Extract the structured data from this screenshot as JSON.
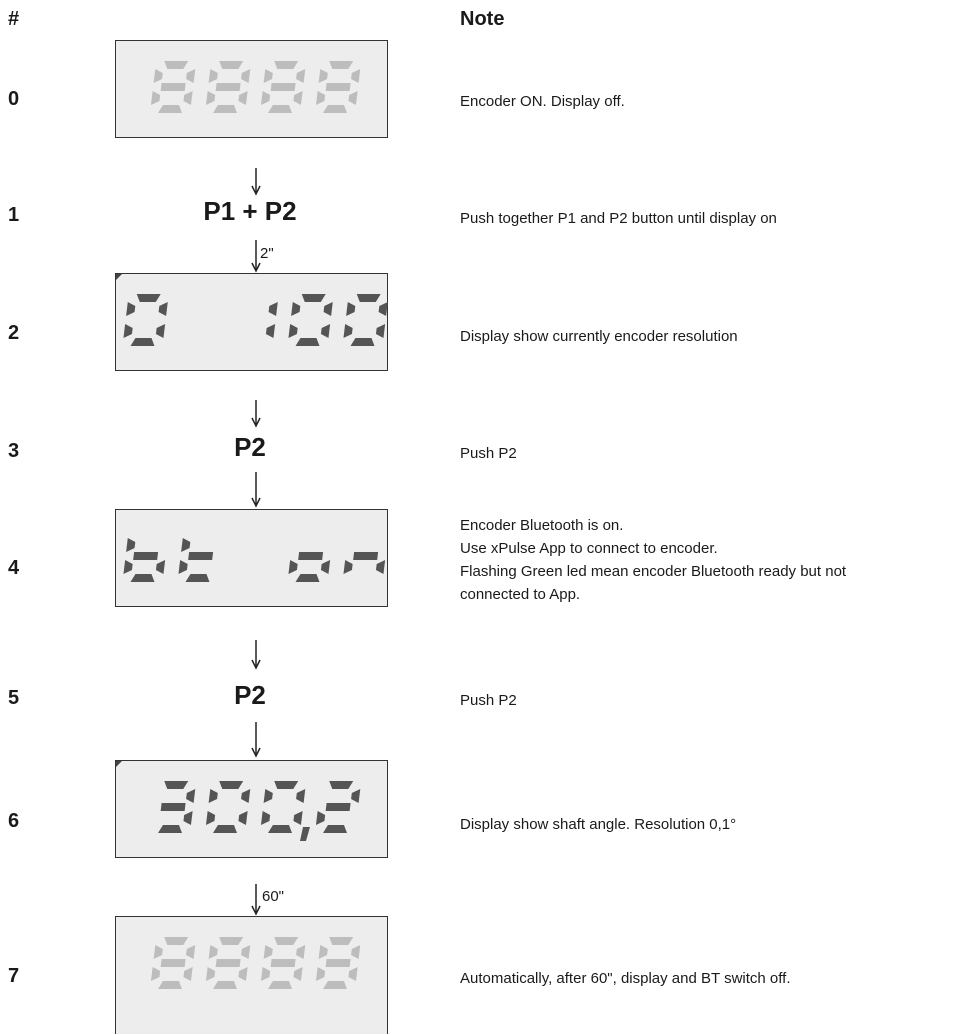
{
  "header": {
    "step_col": "#",
    "note_col": "Note"
  },
  "steps": [
    {
      "num": "0",
      "display": "8888",
      "dim": true,
      "notes": [
        "Encoder ON. Display off."
      ]
    },
    {
      "num": "1",
      "button": "P1 + P2",
      "notes": [
        "Push together P1 and P2 button until display on"
      ]
    },
    {
      "num": "2",
      "display": "0 100",
      "dim": false,
      "notes": [
        "Display show currently encoder resolution"
      ]
    },
    {
      "num": "3",
      "button": "P2",
      "notes": [
        "Push P2"
      ]
    },
    {
      "num": "4",
      "display": "bt on",
      "dim": false,
      "notes": [
        "Encoder Bluetooth is on.",
        "Use xPulse App to connect to encoder.",
        "Flashing Green led mean encoder Bluetooth ready but not",
        "connected to App."
      ]
    },
    {
      "num": "5",
      "button": "P2",
      "notes": [
        "Push P2"
      ]
    },
    {
      "num": "6",
      "display": "300,2",
      "dim": false,
      "notes": [
        "Display show shaft angle. Resolution 0,1°"
      ]
    },
    {
      "num": "7",
      "display": "8888",
      "dim": true,
      "notes": [
        "Automatically, after 60\", display and BT switch off."
      ]
    }
  ],
  "delays": {
    "hold": "2\"",
    "timeout": "60\""
  },
  "colors": {
    "segment_on": "#555555",
    "segment_dim": "#bdbdbd",
    "lcd_bg": "#ededed"
  }
}
